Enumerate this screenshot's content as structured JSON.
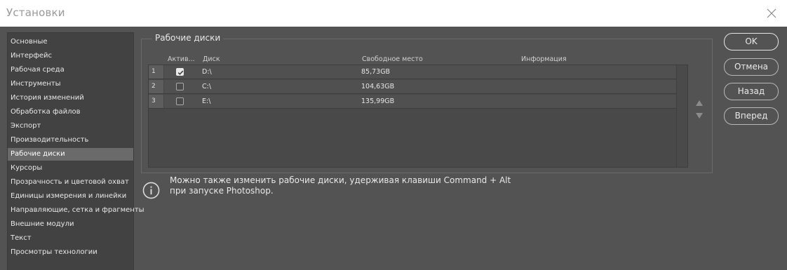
{
  "window": {
    "title": "Установки"
  },
  "sidebar": {
    "items": [
      {
        "label": "Основные"
      },
      {
        "label": "Интерфейс"
      },
      {
        "label": "Рабочая среда"
      },
      {
        "label": "Инструменты"
      },
      {
        "label": "История изменений"
      },
      {
        "label": "Обработка файлов"
      },
      {
        "label": "Экспорт"
      },
      {
        "label": "Производительность"
      },
      {
        "label": "Рабочие диски",
        "active": true
      },
      {
        "label": "Курсоры"
      },
      {
        "label": "Прозрачность и цветовой охват"
      },
      {
        "label": "Единицы измерения и линейки"
      },
      {
        "label": "Направляющие, сетка и фрагменты"
      },
      {
        "label": "Внешние модули"
      },
      {
        "label": "Текст"
      },
      {
        "label": "Просмотры технологии"
      }
    ]
  },
  "scratch": {
    "group_title": "Рабочие диски",
    "columns": {
      "active": "Актив...",
      "disk": "Диск",
      "free": "Свободное место",
      "info": "Информация"
    },
    "rows": [
      {
        "num": "1",
        "checked": true,
        "disk": "D:\\",
        "free": "85,73GB",
        "info": ""
      },
      {
        "num": "2",
        "checked": false,
        "disk": "C:\\",
        "free": "104,63GB",
        "info": ""
      },
      {
        "num": "3",
        "checked": false,
        "disk": "E:\\",
        "free": "135,99GB",
        "info": ""
      }
    ]
  },
  "note": {
    "line1": "Можно также изменить рабочие диски, удерживая клавиши Command + Alt",
    "line2": "при запуске Photoshop."
  },
  "buttons": {
    "ok": "OK",
    "cancel": "Отмена",
    "back": "Назад",
    "forward": "Вперед"
  },
  "icons": {
    "close": "close-icon",
    "info": "info-icon",
    "move_up": "triangle-up-icon",
    "move_down": "triangle-down-icon",
    "check": "checkmark-icon"
  },
  "colors": {
    "background": "#535353",
    "sidebar": "#424242",
    "active_item": "#6a6a6a",
    "title_bar": "#ffffff"
  }
}
